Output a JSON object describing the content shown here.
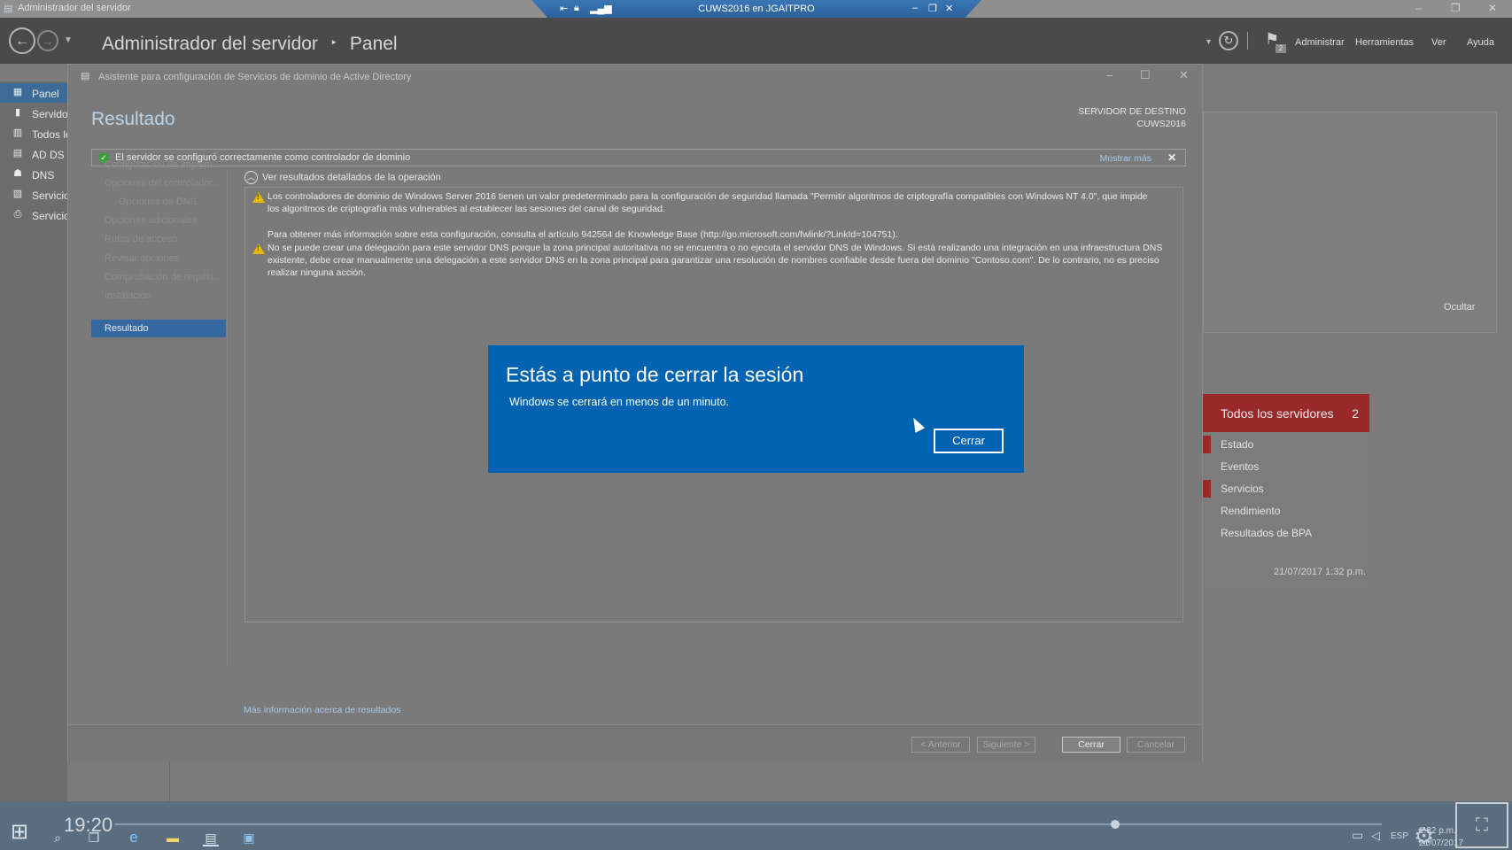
{
  "window": {
    "title": "Administrador del servidor",
    "minimize_icon": "minimize-icon",
    "restore_icon": "restore-icon",
    "close_icon": "close-icon"
  },
  "remote_bar": {
    "title": "CUWS2016 en JGAITPRO",
    "pin_icon": "pin-icon",
    "lock_icon": "lock-icon",
    "signal_icon": "signal-icon"
  },
  "header": {
    "app": "Administrador del servidor",
    "separator": "‣",
    "page": "Panel",
    "menu": [
      "Administrar",
      "Herramientas",
      "Ver",
      "Ayuda"
    ],
    "notification_count": "2"
  },
  "nav": [
    {
      "label": "Panel",
      "icon": "dashboard-icon",
      "active": true
    },
    {
      "label": "Servidor local",
      "icon": "server-icon"
    },
    {
      "label": "Todos los servidores",
      "icon": "servers-icon"
    },
    {
      "label": "AD DS",
      "icon": "ad-ds-icon"
    },
    {
      "label": "DNS",
      "icon": "dns-icon"
    },
    {
      "label": "Servicios de archivos",
      "icon": "file-services-icon"
    },
    {
      "label": "Servicios de impresión",
      "icon": "print-services-icon"
    }
  ],
  "right_panel": {
    "hide_label": "Ocultar",
    "card": {
      "title": "Todos los servidores",
      "count": "2",
      "rows": [
        "Estado",
        "Eventos",
        "Servicios",
        "Rendimiento",
        "Resultados de BPA"
      ],
      "timestamp": "21/07/2017 1:32 p.m."
    }
  },
  "wizard": {
    "title": "Asistente para configuración de Servicios de dominio de Active Directory",
    "heading": "Resultado",
    "destination_label": "SERVIDOR DE DESTINO",
    "destination_server": "CUWS2016",
    "success_message": "El servidor se configuró correctamente como controlador de dominio",
    "show_more": "Mostrar más",
    "steps": [
      "Configuración de implem...",
      "Opciones del controlador...",
      "Opciones de DNS",
      "Opciones adicionales",
      "Rutas de acceso",
      "Revisar opciones",
      "Comprobación de requisi...",
      "Instalación",
      "Resultado"
    ],
    "toggle_label": "Ver resultados detallados de la operación",
    "results": {
      "warning1_line1": "Los controladores de dominio de Windows Server 2016 tienen un valor predeterminado para la configuración de seguridad llamada \"Permitir algoritmos de criptografía compatibles con Windows NT 4.0\", que impide",
      "warning1_line2": "los algoritmos de criptografía más vulnerables al establecer las sesiones del canal de seguridad.",
      "info": "Para obtener más información sobre esta configuración, consulta el artículo 942564 de Knowledge Base (http://go.microsoft.com/fwlink/?LinkId=104751).",
      "warning2_line1": "No se puede crear una delegación para este servidor DNS porque la zona principal autoritativa no se encuentra o no ejecuta el servidor DNS de Windows. Si está realizando una integración en una infraestructura DNS",
      "warning2_line2": "existente, debe crear manualmente una delegación a este servidor DNS en la zona principal para garantizar una resolución de nombres confiable desde fuera del dominio \"Contoso.com\". De lo contrario, no es preciso",
      "warning2_line3": "realizar ninguna acción."
    },
    "more_info_link": "Más información acerca de resultados",
    "buttons": {
      "previous": "< Anterior",
      "next": "Siguiente >",
      "close": "Cerrar",
      "cancel": "Cancelar"
    }
  },
  "dialog": {
    "title": "Estás a punto de cerrar la sesión",
    "subtitle": "Windows se cerrará en menos de un minuto.",
    "button": "Cerrar"
  },
  "taskbar": {
    "clock": "19:20",
    "language": "ESP",
    "tray_time": "1:32 p.m.",
    "tray_date": "21/07/2017"
  },
  "colors": {
    "dialog_blue": "#0063b1",
    "alert_red": "#9a2a2a",
    "link_blue": "#a8c8e8"
  }
}
